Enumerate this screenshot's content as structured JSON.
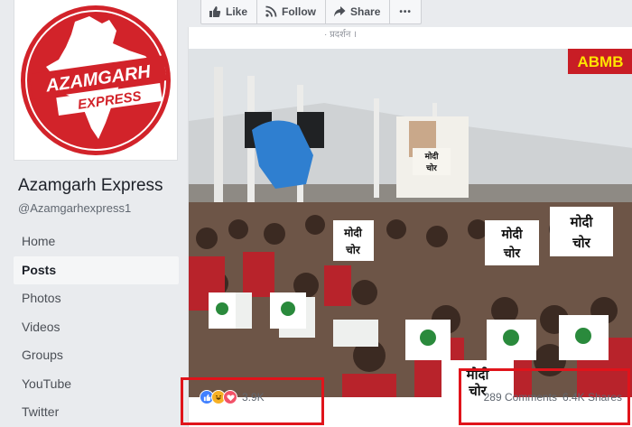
{
  "page": {
    "name": "Azamgarh Express",
    "handle": "@Azamgarhexpress1",
    "logo": {
      "line1": "AZAMGARH",
      "line2": "EXPRESS",
      "accent": "#d2232a"
    }
  },
  "nav": {
    "items": [
      {
        "label": "Home"
      },
      {
        "label": "Posts",
        "active": true
      },
      {
        "label": "Photos"
      },
      {
        "label": "Videos"
      },
      {
        "label": "Groups"
      },
      {
        "label": "YouTube"
      },
      {
        "label": "Twitter"
      }
    ]
  },
  "actions": {
    "like_label": "Like",
    "follow_label": "Follow",
    "share_label": "Share",
    "more_label": "•••"
  },
  "post": {
    "snippet": "· प्रदर्शन ।",
    "photo": {
      "watermark": "ABMB",
      "placards": [
        "मोदी",
        "चोर"
      ],
      "banner": "मोदी चोर"
    },
    "reactions": {
      "count": "3.9K",
      "icons": [
        "like-icon",
        "haha-icon",
        "love-icon"
      ],
      "colors": {
        "like": "#4080ff",
        "haha": "#f7b125",
        "love": "#f25268"
      }
    },
    "comments_label": "289 Comments",
    "shares_label": "6.4K Shares"
  },
  "colors": {
    "highlight": "#e0141b",
    "background": "#e9ebee"
  }
}
